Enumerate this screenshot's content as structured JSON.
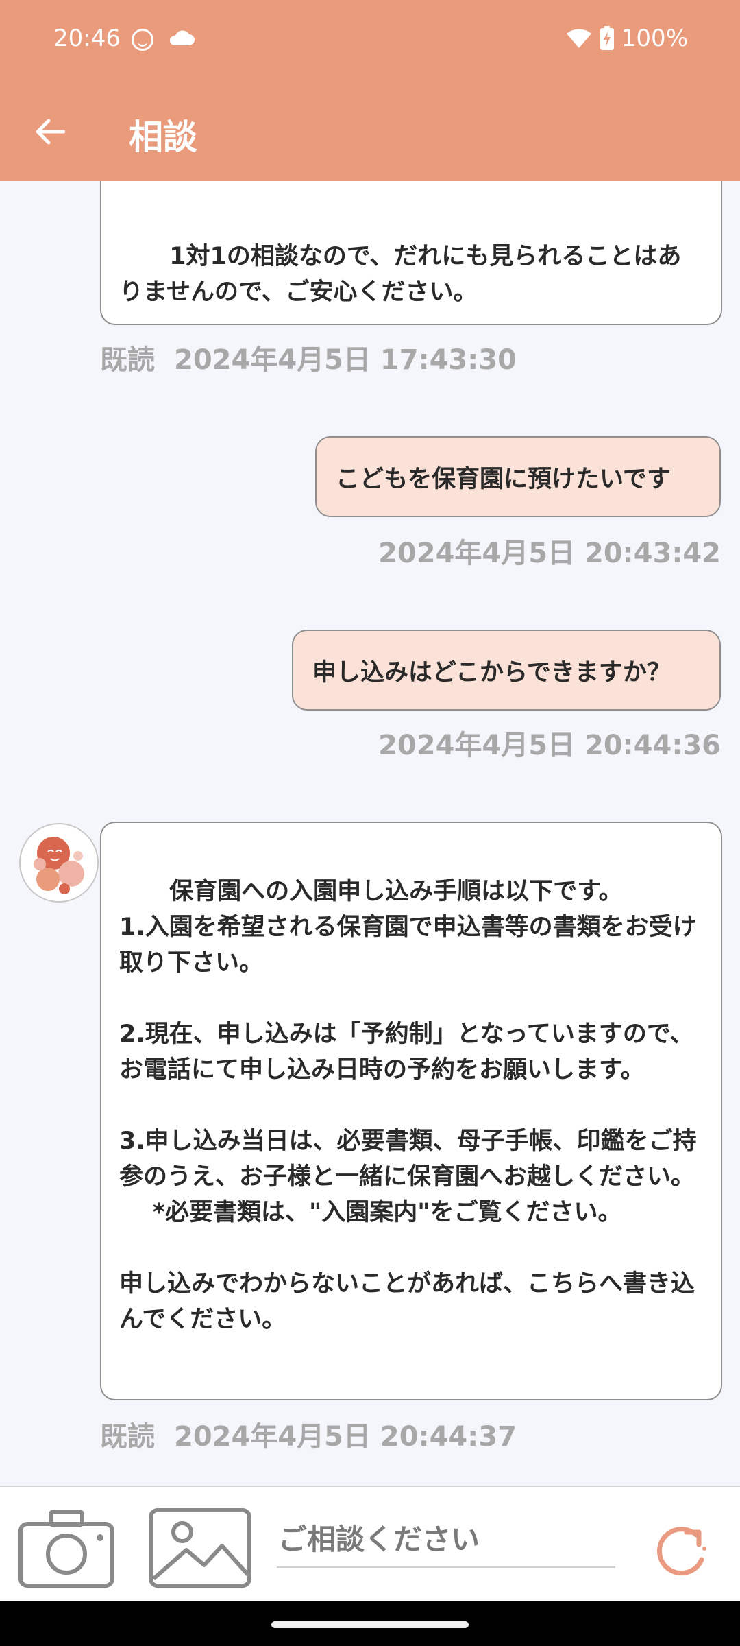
{
  "status_bar": {
    "time": "20:46",
    "battery": "100%"
  },
  "header": {
    "title": "相談",
    "back_icon": "arrow-left-icon"
  },
  "messages": [
    {
      "from": "bot",
      "text": "1対1の相談なので、だれにも見られることはありませんので、ご安心ください。",
      "read_label": "既読",
      "timestamp": "2024年4月5日 17:43:30"
    },
    {
      "from": "user",
      "text": "こどもを保育園に預けたいです",
      "timestamp": "2024年4月5日 20:43:42"
    },
    {
      "from": "user",
      "text": "申し込みはどこからできますか？",
      "timestamp": "2024年4月5日 20:44:36"
    },
    {
      "from": "bot",
      "text": "保育園への入園申し込み手順は以下です。\n1.入園を希望される保育園で申込書等の書類をお受け取り下さい。\n\n2.現在、申し込みは「予約制」となっていますので、お電話にて申し込み日時の予約をお願いします。\n\n3.申し込み当日は、必要書類、母子手帳、印鑑をご持参のうえ、お子様と一緒に保育園へお越しください。\n    *必要書類は、\"入園案内\"をご覧ください。\n\n申し込みでわからないことがあれば、こちらへ書き込んでください。",
      "read_label": "既読",
      "timestamp": "2024年4月5日 20:44:37"
    }
  ],
  "composer": {
    "placeholder": "ご相談ください",
    "camera_icon": "camera-icon",
    "gallery_icon": "image-icon",
    "send_icon": "refresh-icon"
  },
  "colors": {
    "header": "#e99b7c",
    "user_bubble": "#fbe2d8",
    "background": "#f5f6fb"
  }
}
